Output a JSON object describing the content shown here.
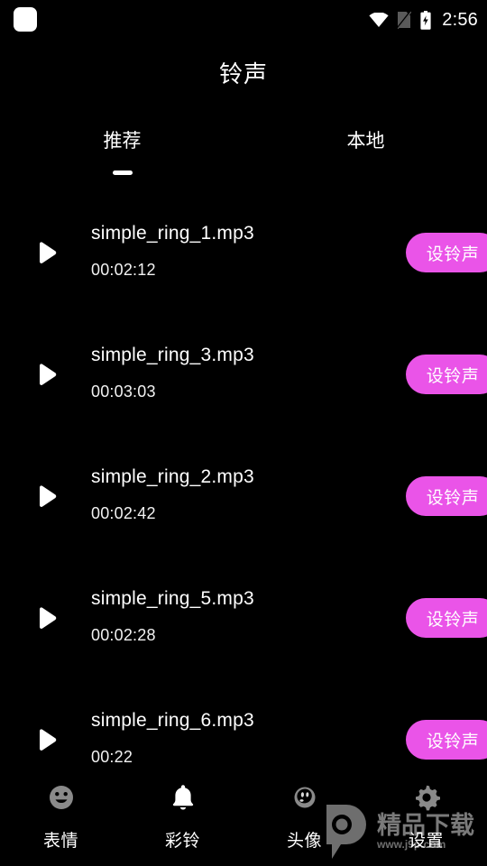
{
  "statusbar": {
    "notification_icon": "rounded-square-icon",
    "wifi_icon": "wifi-icon",
    "sim_icon": "sim-card-off-icon",
    "battery_icon": "battery-charging-icon",
    "time": "2:56"
  },
  "header": {
    "title": "铃声"
  },
  "tabs": {
    "items": [
      {
        "label": "推荐",
        "selected": true
      },
      {
        "label": "本地",
        "selected": false
      }
    ]
  },
  "list": {
    "play_icon": "play-icon",
    "set_label": "设铃声",
    "rows": [
      {
        "name": "simple_ring_1.mp3",
        "duration": "00:02:12",
        "action": "设铃声"
      },
      {
        "name": "simple_ring_3.mp3",
        "duration": "00:03:03",
        "action": "设铃声"
      },
      {
        "name": "simple_ring_2.mp3",
        "duration": "00:02:42",
        "action": "设铃声"
      },
      {
        "name": "simple_ring_5.mp3",
        "duration": "00:02:28",
        "action": "设铃声"
      },
      {
        "name": "simple_ring_6.mp3",
        "duration": "00:22",
        "action": "设铃声"
      }
    ]
  },
  "bottomnav": {
    "items": [
      {
        "label": "表情",
        "icon": "smiley-icon",
        "active": false
      },
      {
        "label": "彩铃",
        "icon": "bell-icon",
        "active": true
      },
      {
        "label": "头像",
        "icon": "avatar-icon",
        "active": false
      },
      {
        "label": "设置",
        "icon": "gear-icon",
        "active": false
      }
    ]
  },
  "watermark": {
    "logo": "p-logo-icon",
    "text": "精品下载",
    "url": "www.j9p.com"
  },
  "colors": {
    "background": "#000000",
    "accent": "#ea54e8",
    "text": "#ffffff",
    "inactive_icon": "#8a8a8a",
    "watermark": "#777777"
  }
}
